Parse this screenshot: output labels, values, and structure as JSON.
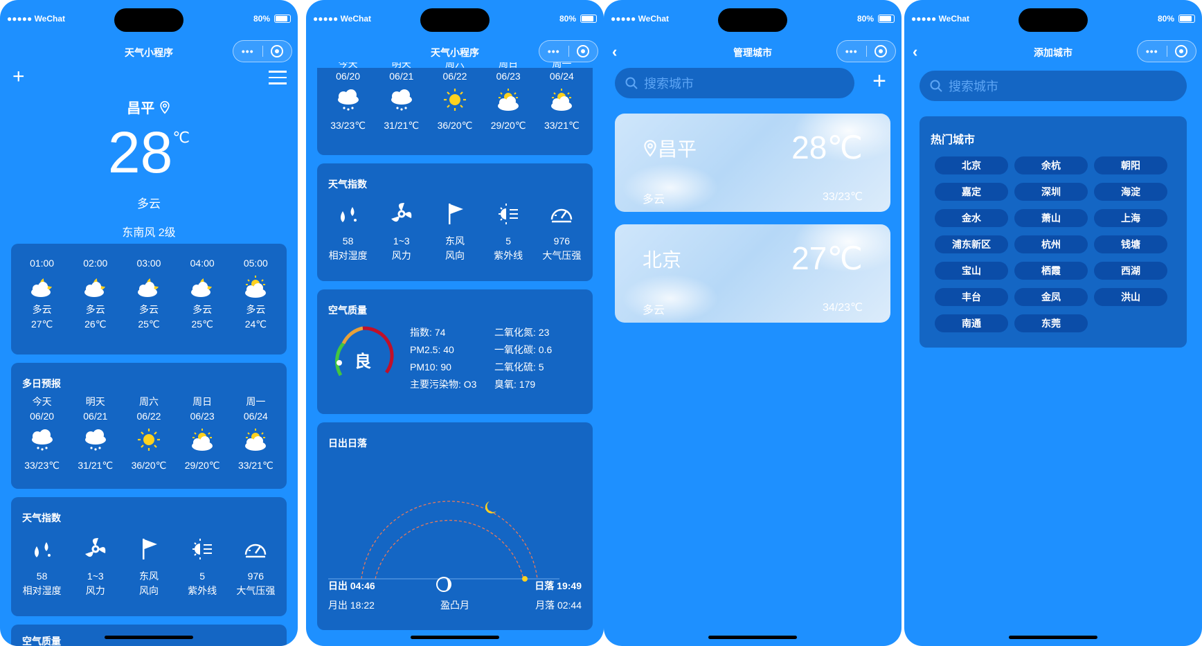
{
  "status": {
    "carrier": "●●●●● WeChat",
    "battery": "80%"
  },
  "screen1": {
    "title": "天气小程序",
    "city": "昌平",
    "temp": "28",
    "unit": "℃",
    "condition": "多云",
    "wind": "东南风 2级",
    "hourly": [
      {
        "time": "01:00",
        "icon": "moon-cloud-icon",
        "cond": "多云",
        "temp": "27℃"
      },
      {
        "time": "02:00",
        "icon": "moon-cloud-icon",
        "cond": "多云",
        "temp": "26℃"
      },
      {
        "time": "03:00",
        "icon": "moon-cloud-icon",
        "cond": "多云",
        "temp": "25℃"
      },
      {
        "time": "04:00",
        "icon": "moon-cloud-icon",
        "cond": "多云",
        "temp": "25℃"
      },
      {
        "time": "05:00",
        "icon": "sun-cloud-icon",
        "cond": "多云",
        "temp": "24℃"
      }
    ],
    "forecast_title": "多日预报",
    "forecast": [
      {
        "day": "今天",
        "date": "06/20",
        "icon": "rain-cloud-icon",
        "range": "33/23℃"
      },
      {
        "day": "明天",
        "date": "06/21",
        "icon": "rain-cloud-icon",
        "range": "31/21℃"
      },
      {
        "day": "周六",
        "date": "06/22",
        "icon": "sun-icon",
        "range": "36/20℃"
      },
      {
        "day": "周日",
        "date": "06/23",
        "icon": "sun-cloud-icon",
        "range": "29/20℃"
      },
      {
        "day": "周一",
        "date": "06/24",
        "icon": "sun-cloud-icon",
        "range": "33/21℃"
      }
    ],
    "index_title": "天气指数",
    "indices": [
      {
        "icon": "humidity-icon",
        "value": "58",
        "label": "相对湿度"
      },
      {
        "icon": "wind-icon",
        "value": "1~3",
        "label": "风力"
      },
      {
        "icon": "flag-icon",
        "value": "东风",
        "label": "风向"
      },
      {
        "icon": "uv-icon",
        "value": "5",
        "label": "紫外线"
      },
      {
        "icon": "gauge-icon",
        "value": "976",
        "label": "大气压强"
      }
    ],
    "air_title_partial": "空气质量"
  },
  "screen2": {
    "title": "天气小程序",
    "forecast_partial_days": [
      "今天",
      "明天",
      "周六",
      "周日",
      "周一"
    ],
    "forecast": [
      {
        "date": "06/20",
        "icon": "rain-cloud-icon",
        "range": "33/23℃"
      },
      {
        "date": "06/21",
        "icon": "rain-cloud-icon",
        "range": "31/21℃"
      },
      {
        "date": "06/22",
        "icon": "sun-icon",
        "range": "36/20℃"
      },
      {
        "date": "06/23",
        "icon": "sun-cloud-icon",
        "range": "29/20℃"
      },
      {
        "date": "06/24",
        "icon": "sun-cloud-icon",
        "range": "33/21℃"
      }
    ],
    "index_title": "天气指数",
    "indices": [
      {
        "icon": "humidity-icon",
        "value": "58",
        "label": "相对湿度"
      },
      {
        "icon": "wind-icon",
        "value": "1~3",
        "label": "风力"
      },
      {
        "icon": "flag-icon",
        "value": "东风",
        "label": "风向"
      },
      {
        "icon": "uv-icon",
        "value": "5",
        "label": "紫外线"
      },
      {
        "icon": "gauge-icon",
        "value": "976",
        "label": "大气压强"
      }
    ],
    "air": {
      "title": "空气质量",
      "grade": "良",
      "index": "指数: 74",
      "pm25": "PM2.5: 40",
      "pm10": "PM10: 90",
      "main": "主要污染物: O3",
      "no2": "二氧化氮: 23",
      "co": "一氧化碳: 0.6",
      "so2": "二氧化硫: 5",
      "o3": "臭氧: 179"
    },
    "sun": {
      "title": "日出日落",
      "sunrise": "日出 04:46",
      "sunset": "日落 19:49",
      "moonrise": "月出 18:22",
      "moonset": "月落 02:44",
      "phase": "盈凸月"
    }
  },
  "screen3": {
    "title": "管理城市",
    "search_placeholder": "搜索城市",
    "cities": [
      {
        "name": "昌平",
        "temp": "28℃",
        "cond": "多云",
        "range": "33/23℃",
        "located": true
      },
      {
        "name": "北京",
        "temp": "27℃",
        "cond": "多云",
        "range": "34/23℃",
        "located": false
      }
    ]
  },
  "screen4": {
    "title": "添加城市",
    "search_placeholder": "搜索城市",
    "hot_title": "热门城市",
    "hot_cities": [
      "北京",
      "余杭",
      "朝阳",
      "嘉定",
      "深圳",
      "海淀",
      "金水",
      "萧山",
      "上海",
      "浦东新区",
      "杭州",
      "钱塘",
      "宝山",
      "栖霞",
      "西湖",
      "丰台",
      "金凤",
      "洪山",
      "南通",
      "东莞"
    ]
  },
  "colors": {
    "bg": "#1e90ff",
    "card": "#1466c4",
    "chip": "#0b4da8"
  }
}
